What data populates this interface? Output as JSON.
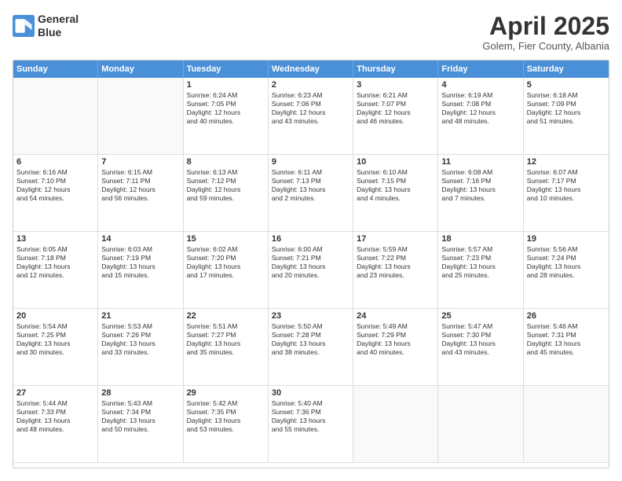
{
  "logo": {
    "line1": "General",
    "line2": "Blue"
  },
  "header": {
    "month": "April 2025",
    "location": "Golem, Fier County, Albania"
  },
  "weekdays": [
    "Sunday",
    "Monday",
    "Tuesday",
    "Wednesday",
    "Thursday",
    "Friday",
    "Saturday"
  ],
  "weeks": [
    [
      {
        "day": "",
        "lines": []
      },
      {
        "day": "",
        "lines": []
      },
      {
        "day": "1",
        "lines": [
          "Sunrise: 6:24 AM",
          "Sunset: 7:05 PM",
          "Daylight: 12 hours",
          "and 40 minutes."
        ]
      },
      {
        "day": "2",
        "lines": [
          "Sunrise: 6:23 AM",
          "Sunset: 7:06 PM",
          "Daylight: 12 hours",
          "and 43 minutes."
        ]
      },
      {
        "day": "3",
        "lines": [
          "Sunrise: 6:21 AM",
          "Sunset: 7:07 PM",
          "Daylight: 12 hours",
          "and 46 minutes."
        ]
      },
      {
        "day": "4",
        "lines": [
          "Sunrise: 6:19 AM",
          "Sunset: 7:08 PM",
          "Daylight: 12 hours",
          "and 48 minutes."
        ]
      },
      {
        "day": "5",
        "lines": [
          "Sunrise: 6:18 AM",
          "Sunset: 7:09 PM",
          "Daylight: 12 hours",
          "and 51 minutes."
        ]
      }
    ],
    [
      {
        "day": "6",
        "lines": [
          "Sunrise: 6:16 AM",
          "Sunset: 7:10 PM",
          "Daylight: 12 hours",
          "and 54 minutes."
        ]
      },
      {
        "day": "7",
        "lines": [
          "Sunrise: 6:15 AM",
          "Sunset: 7:11 PM",
          "Daylight: 12 hours",
          "and 56 minutes."
        ]
      },
      {
        "day": "8",
        "lines": [
          "Sunrise: 6:13 AM",
          "Sunset: 7:12 PM",
          "Daylight: 12 hours",
          "and 59 minutes."
        ]
      },
      {
        "day": "9",
        "lines": [
          "Sunrise: 6:11 AM",
          "Sunset: 7:13 PM",
          "Daylight: 13 hours",
          "and 2 minutes."
        ]
      },
      {
        "day": "10",
        "lines": [
          "Sunrise: 6:10 AM",
          "Sunset: 7:15 PM",
          "Daylight: 13 hours",
          "and 4 minutes."
        ]
      },
      {
        "day": "11",
        "lines": [
          "Sunrise: 6:08 AM",
          "Sunset: 7:16 PM",
          "Daylight: 13 hours",
          "and 7 minutes."
        ]
      },
      {
        "day": "12",
        "lines": [
          "Sunrise: 6:07 AM",
          "Sunset: 7:17 PM",
          "Daylight: 13 hours",
          "and 10 minutes."
        ]
      }
    ],
    [
      {
        "day": "13",
        "lines": [
          "Sunrise: 6:05 AM",
          "Sunset: 7:18 PM",
          "Daylight: 13 hours",
          "and 12 minutes."
        ]
      },
      {
        "day": "14",
        "lines": [
          "Sunrise: 6:03 AM",
          "Sunset: 7:19 PM",
          "Daylight: 13 hours",
          "and 15 minutes."
        ]
      },
      {
        "day": "15",
        "lines": [
          "Sunrise: 6:02 AM",
          "Sunset: 7:20 PM",
          "Daylight: 13 hours",
          "and 17 minutes."
        ]
      },
      {
        "day": "16",
        "lines": [
          "Sunrise: 6:00 AM",
          "Sunset: 7:21 PM",
          "Daylight: 13 hours",
          "and 20 minutes."
        ]
      },
      {
        "day": "17",
        "lines": [
          "Sunrise: 5:59 AM",
          "Sunset: 7:22 PM",
          "Daylight: 13 hours",
          "and 23 minutes."
        ]
      },
      {
        "day": "18",
        "lines": [
          "Sunrise: 5:57 AM",
          "Sunset: 7:23 PM",
          "Daylight: 13 hours",
          "and 25 minutes."
        ]
      },
      {
        "day": "19",
        "lines": [
          "Sunrise: 5:56 AM",
          "Sunset: 7:24 PM",
          "Daylight: 13 hours",
          "and 28 minutes."
        ]
      }
    ],
    [
      {
        "day": "20",
        "lines": [
          "Sunrise: 5:54 AM",
          "Sunset: 7:25 PM",
          "Daylight: 13 hours",
          "and 30 minutes."
        ]
      },
      {
        "day": "21",
        "lines": [
          "Sunrise: 5:53 AM",
          "Sunset: 7:26 PM",
          "Daylight: 13 hours",
          "and 33 minutes."
        ]
      },
      {
        "day": "22",
        "lines": [
          "Sunrise: 5:51 AM",
          "Sunset: 7:27 PM",
          "Daylight: 13 hours",
          "and 35 minutes."
        ]
      },
      {
        "day": "23",
        "lines": [
          "Sunrise: 5:50 AM",
          "Sunset: 7:28 PM",
          "Daylight: 13 hours",
          "and 38 minutes."
        ]
      },
      {
        "day": "24",
        "lines": [
          "Sunrise: 5:49 AM",
          "Sunset: 7:29 PM",
          "Daylight: 13 hours",
          "and 40 minutes."
        ]
      },
      {
        "day": "25",
        "lines": [
          "Sunrise: 5:47 AM",
          "Sunset: 7:30 PM",
          "Daylight: 13 hours",
          "and 43 minutes."
        ]
      },
      {
        "day": "26",
        "lines": [
          "Sunrise: 5:46 AM",
          "Sunset: 7:31 PM",
          "Daylight: 13 hours",
          "and 45 minutes."
        ]
      }
    ],
    [
      {
        "day": "27",
        "lines": [
          "Sunrise: 5:44 AM",
          "Sunset: 7:33 PM",
          "Daylight: 13 hours",
          "and 48 minutes."
        ]
      },
      {
        "day": "28",
        "lines": [
          "Sunrise: 5:43 AM",
          "Sunset: 7:34 PM",
          "Daylight: 13 hours",
          "and 50 minutes."
        ]
      },
      {
        "day": "29",
        "lines": [
          "Sunrise: 5:42 AM",
          "Sunset: 7:35 PM",
          "Daylight: 13 hours",
          "and 53 minutes."
        ]
      },
      {
        "day": "30",
        "lines": [
          "Sunrise: 5:40 AM",
          "Sunset: 7:36 PM",
          "Daylight: 13 hours",
          "and 55 minutes."
        ]
      },
      {
        "day": "",
        "lines": []
      },
      {
        "day": "",
        "lines": []
      },
      {
        "day": "",
        "lines": []
      }
    ]
  ]
}
